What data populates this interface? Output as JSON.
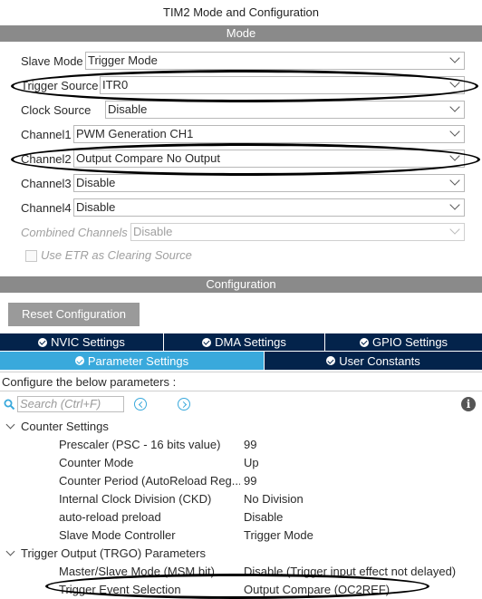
{
  "window": {
    "title": "TIM2 Mode and Configuration"
  },
  "mode": {
    "header": "Mode",
    "rows": [
      {
        "label": "Slave Mode",
        "value": "Trigger Mode"
      },
      {
        "label": "Trigger Source",
        "value": "ITR0"
      },
      {
        "label": "Clock Source",
        "value": "Disable"
      },
      {
        "label": "Channel1",
        "value": "PWM Generation CH1"
      },
      {
        "label": "Channel2",
        "value": "Output Compare No Output"
      },
      {
        "label": "Channel3",
        "value": "Disable"
      },
      {
        "label": "Channel4",
        "value": "Disable"
      },
      {
        "label": "Combined Channels",
        "value": "Disable"
      }
    ],
    "etr_checkbox_label": "Use ETR as Clearing Source"
  },
  "configuration": {
    "header": "Configuration",
    "reset_button": "Reset Configuration",
    "tabs_row1": [
      "NVIC Settings",
      "DMA Settings",
      "GPIO Settings"
    ],
    "tabs_row2": [
      "Parameter Settings",
      "User Constants"
    ],
    "active_tab": "Parameter Settings",
    "configure_text": "Configure the below parameters :",
    "search_placeholder": "Search (Ctrl+F)",
    "groups": [
      {
        "name": "Counter Settings",
        "params": [
          {
            "name": "Prescaler (PSC - 16 bits value)",
            "value": "99"
          },
          {
            "name": "Counter Mode",
            "value": "Up"
          },
          {
            "name": "Counter Period (AutoReload Reg...",
            "value": "99"
          },
          {
            "name": "Internal Clock Division (CKD)",
            "value": "No Division"
          },
          {
            "name": "auto-reload preload",
            "value": "Disable"
          },
          {
            "name": "Slave Mode Controller",
            "value": "Trigger Mode"
          }
        ]
      },
      {
        "name": "Trigger Output (TRGO) Parameters",
        "params": [
          {
            "name": "Master/Slave Mode (MSM bit)",
            "value": "Disable (Trigger input effect not delayed)"
          },
          {
            "name": "Trigger Event Selection",
            "value": "Output Compare (OC2REF)"
          }
        ]
      }
    ]
  },
  "colors": {
    "band_gray": "#8a8a8a",
    "tab_navy": "#03234b",
    "tab_active": "#39a9dc"
  },
  "icons": [
    "chevron-down-icon",
    "check-circle-icon",
    "search-icon",
    "prev-arrow-icon",
    "next-arrow-icon",
    "info-icon",
    "caret-down-icon"
  ]
}
